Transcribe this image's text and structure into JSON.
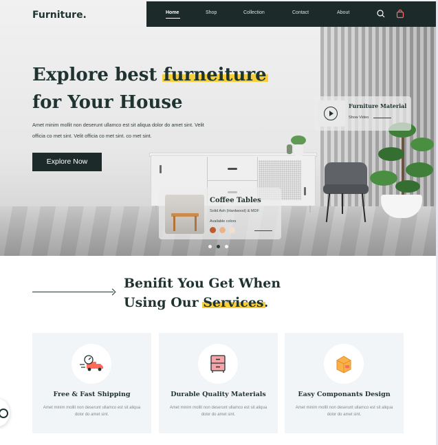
{
  "brand": {
    "logo": "Furniture."
  },
  "nav": {
    "links": [
      "Home",
      "Shop",
      "Collection",
      "Contact",
      "About"
    ],
    "active": "Home",
    "icons": [
      "search-icon",
      "shopping-bag-icon"
    ]
  },
  "hero": {
    "title_line1_plain": "Explore best ",
    "title_line1_highlight": "furneiture",
    "title_line2": "for Your House",
    "description": "Amet minim mollit non deserunt ullamco est sit aliqua dolor do amet sint. Velit officia co met sint. Velit officia co met sint. co met sint.",
    "cta": "Explore Now"
  },
  "material_card": {
    "title": "Furniture Material",
    "link": "Show Video",
    "icon": "play-icon"
  },
  "product_card": {
    "title": "Coffee Tables",
    "subtitle": "Solid Ash (Hardwood) & MDF",
    "colors_label": "Available colors",
    "colors": [
      "#c0592b",
      "#e9b48c",
      "#f3dfcf"
    ]
  },
  "carousel": {
    "count": 3,
    "active_index": 1
  },
  "benefits": {
    "title_line1": "Benifit You Get When",
    "title_line2_plain": "Using Our ",
    "title_line2_highlight": "Services",
    "title_punct": ".",
    "cards": [
      {
        "icon": "delivery-truck-icon",
        "title": "Free & Fast Shipping",
        "desc": "Amet minim mollit non deserunt ullamco est sit aliqua dolor do amet sint."
      },
      {
        "icon": "cabinet-icon",
        "title": "Durable Quality Materials",
        "desc": "Amet minim mollit non deserunt ullamco est sit aliqua dolor do amet sint."
      },
      {
        "icon": "package-box-icon",
        "title": "Easy Componants Design",
        "desc": "Amet minim mollit non deserunt ullamco est sit aliqua dolor do amet sint."
      }
    ]
  },
  "colors": {
    "dark_green": "#1c2b2a",
    "highlight": "#f6cf3a",
    "card_bg": "#f1f5f8"
  }
}
